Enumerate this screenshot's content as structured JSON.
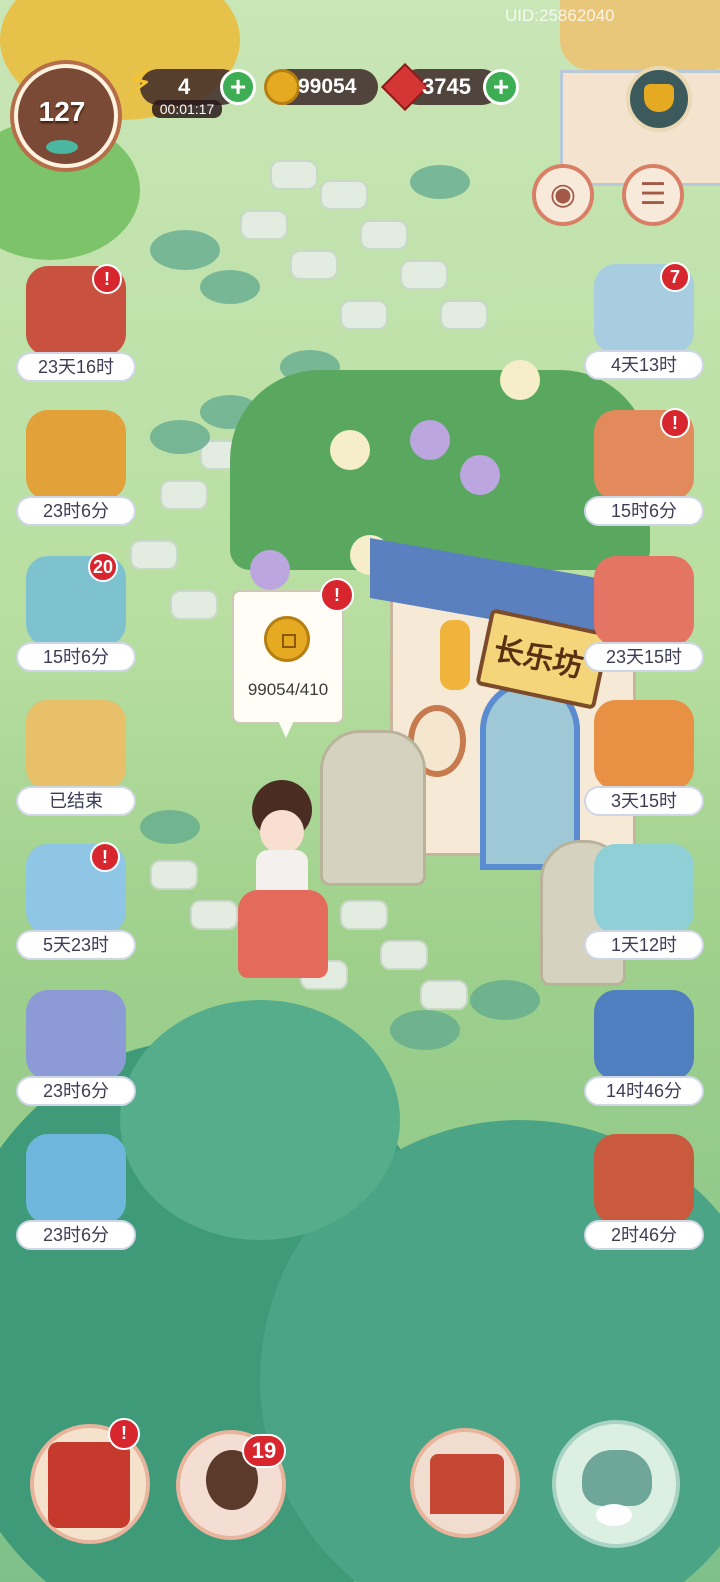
{
  "uid": "UID:25862040",
  "level": "127",
  "energy": {
    "value": "4",
    "timer": "00:01:17"
  },
  "coins": "99054",
  "gems": "3745",
  "building_sign": "长乐坊",
  "coin_bubble": {
    "text": "99054/410",
    "alert": "!"
  },
  "left_events": [
    {
      "label": "23天16时",
      "badge": "!"
    },
    {
      "label": "23时6分",
      "badge": ""
    },
    {
      "label": "15时6分",
      "badge": "20"
    },
    {
      "label": "已结束",
      "badge": ""
    },
    {
      "label": "5天23时",
      "badge": "!"
    },
    {
      "label": "23时6分",
      "badge": ""
    },
    {
      "label": "23时6分",
      "badge": ""
    }
  ],
  "right_events": [
    {
      "label": "4天13时",
      "badge": "7"
    },
    {
      "label": "15时6分",
      "badge": "!"
    },
    {
      "label": "23天15时",
      "badge": ""
    },
    {
      "label": "3天15时",
      "badge": ""
    },
    {
      "label": "1天12时",
      "badge": ""
    },
    {
      "label": "14时46分",
      "badge": ""
    },
    {
      "label": "2时46分",
      "badge": ""
    }
  ],
  "bottom_bar": {
    "book_badge": "!",
    "characters_badge": "19"
  },
  "colors": {
    "accent_green": "#3eae55",
    "alert_red": "#d8262f",
    "gem_red": "#d43535",
    "coin_gold": "#e5a922"
  }
}
